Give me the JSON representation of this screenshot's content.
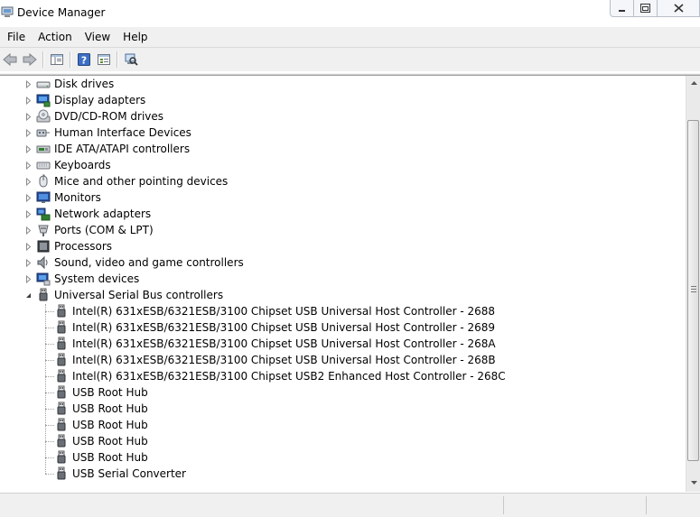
{
  "window": {
    "title": "Device Manager"
  },
  "menu": [
    "File",
    "Action",
    "View",
    "Help"
  ],
  "toolbar": {
    "buttons": [
      "back-arrow-icon",
      "forward-arrow-icon",
      "show-hide-console-tree-icon",
      "help-icon",
      "properties-icon",
      "scan-hardware-changes-icon"
    ]
  },
  "tree": {
    "categories": [
      {
        "label": "Disk drives",
        "icon": "disk-drive-icon"
      },
      {
        "label": "Display adapters",
        "icon": "display-adapter-icon"
      },
      {
        "label": "DVD/CD-ROM drives",
        "icon": "dvd-drive-icon"
      },
      {
        "label": "Human Interface Devices",
        "icon": "hid-icon"
      },
      {
        "label": "IDE ATA/ATAPI controllers",
        "icon": "ide-controller-icon"
      },
      {
        "label": "Keyboards",
        "icon": "keyboard-icon"
      },
      {
        "label": "Mice and other pointing devices",
        "icon": "mouse-icon"
      },
      {
        "label": "Monitors",
        "icon": "monitor-icon"
      },
      {
        "label": "Network adapters",
        "icon": "network-adapter-icon"
      },
      {
        "label": "Ports (COM & LPT)",
        "icon": "port-icon"
      },
      {
        "label": "Processors",
        "icon": "processor-icon"
      },
      {
        "label": "Sound, video and game controllers",
        "icon": "speaker-icon"
      },
      {
        "label": "System devices",
        "icon": "system-device-icon"
      },
      {
        "label": "Universal Serial Bus controllers",
        "icon": "usb-icon",
        "expanded": true
      }
    ],
    "usb_children": [
      "Intel(R) 631xESB/6321ESB/3100 Chipset USB Universal Host Controller - 2688",
      "Intel(R) 631xESB/6321ESB/3100 Chipset USB Universal Host Controller - 2689",
      "Intel(R) 631xESB/6321ESB/3100 Chipset USB Universal Host Controller - 268A",
      "Intel(R) 631xESB/6321ESB/3100 Chipset USB Universal Host Controller - 268B",
      "Intel(R) 631xESB/6321ESB/3100 Chipset USB2 Enhanced Host Controller - 268C",
      "USB Root Hub",
      "USB Root Hub",
      "USB Root Hub",
      "USB Root Hub",
      "USB Root Hub",
      "USB Serial Converter"
    ]
  }
}
